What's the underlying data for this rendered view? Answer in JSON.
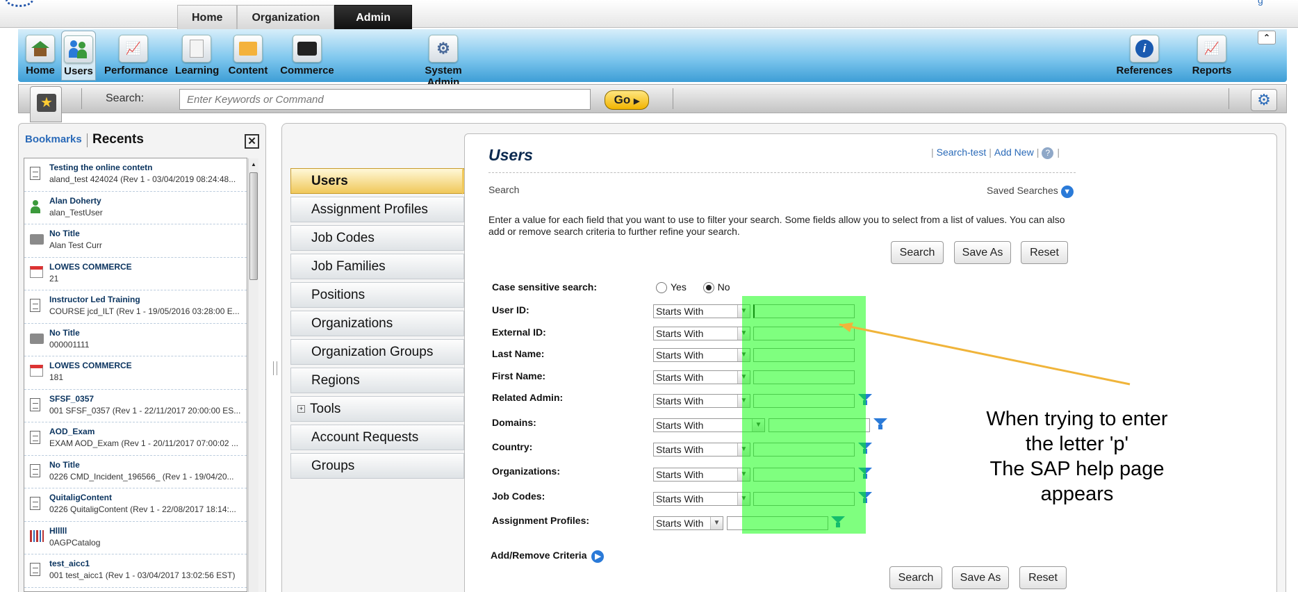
{
  "top_tabs": [
    "Home",
    "Organization",
    "Admin"
  ],
  "nav_items": [
    "Home",
    "Users",
    "Performance",
    "Learning",
    "Content",
    "Commerce",
    "System Admin",
    "References",
    "Reports"
  ],
  "search": {
    "label": "Search:",
    "placeholder": "Enter Keywords or Command",
    "go": "Go"
  },
  "left_panel": {
    "bookmarks_tab": "Bookmarks",
    "recents_tab": "Recents",
    "close": "✕",
    "items": [
      {
        "icon": "document-icon",
        "title": "Testing the online contetn",
        "sub": "aland_test 424024 (Rev 1 - 03/04/2019 08:24:48..."
      },
      {
        "icon": "user-icon",
        "title": "Alan  Doherty",
        "sub": "alan_TestUser"
      },
      {
        "icon": "folder-icon",
        "title": "No Title",
        "sub": "Alan Test Curr"
      },
      {
        "icon": "calendar-icon",
        "title": "LOWES COMMERCE",
        "sub": "21"
      },
      {
        "icon": "document-icon",
        "title": "Instructor Led Training",
        "sub": "COURSE jcd_ILT (Rev 1 - 19/05/2016 03:28:00 E..."
      },
      {
        "icon": "folder-icon",
        "title": "No Title",
        "sub": "000001111"
      },
      {
        "icon": "calendar-icon",
        "title": "LOWES COMMERCE",
        "sub": "181"
      },
      {
        "icon": "document-icon",
        "title": "SFSF_0357",
        "sub": "001 SFSF_0357 (Rev 1 - 22/11/2017 20:00:00 ES..."
      },
      {
        "icon": "document-icon",
        "title": "AOD_Exam",
        "sub": "EXAM AOD_Exam (Rev 1 - 20/11/2017 07:00:02 ..."
      },
      {
        "icon": "document-icon",
        "title": "No Title",
        "sub": "0226 CMD_Incident_196566_ (Rev 1 - 19/04/20..."
      },
      {
        "icon": "document-icon",
        "title": "QuitaligContent",
        "sub": "0226 QuitaligContent (Rev 1 - 22/08/2017 18:14:..."
      },
      {
        "icon": "catalog-icon",
        "title": "Hlllll",
        "sub": "0AGPCatalog"
      },
      {
        "icon": "document-icon",
        "title": "test_aicc1",
        "sub": "001 test_aicc1 (Rev 1 - 03/04/2017 13:02:56 EST)"
      }
    ]
  },
  "sub_nav": [
    "Users",
    "Assignment Profiles",
    "Job Codes",
    "Job Families",
    "Positions",
    "Organizations",
    "Organization Groups",
    "Regions",
    "Tools",
    "Account Requests",
    "Groups"
  ],
  "content": {
    "title": "Users",
    "links": [
      "Search-test",
      "Add New"
    ],
    "help": "?",
    "search_section": "Search",
    "saved_searches": "Saved Searches",
    "instructions": "Enter a value for each field that you want to use to filter your search. Some fields allow you to select from a list of values. You can also add or remove search criteria to further refine your search.",
    "buttons": [
      "Search",
      "Save As",
      "Reset"
    ],
    "case_label": "Case sensitive search:",
    "case_yes": "Yes",
    "case_no": "No",
    "case_selected": "No",
    "fields": [
      {
        "label": "User ID:",
        "op": "Starts With",
        "filter": false
      },
      {
        "label": "External ID:",
        "op": "Starts With",
        "filter": false
      },
      {
        "label": "Last Name:",
        "op": "Starts With",
        "filter": false
      },
      {
        "label": "First Name:",
        "op": "Starts With",
        "filter": false
      },
      {
        "label": "Related Admin:",
        "op": "Starts With",
        "filter": true
      },
      {
        "label": "Domains:",
        "op": "Starts With",
        "filter": true
      },
      {
        "label": "Country:",
        "op": "Starts With",
        "filter": true
      },
      {
        "label": "Organizations:",
        "op": "Starts With",
        "filter": true
      },
      {
        "label": "Job Codes:",
        "op": "Starts With",
        "filter": true
      },
      {
        "label": "Assignment Profiles:",
        "op": "Starts With",
        "filter": true
      }
    ],
    "add_remove": "Add/Remove Criteria"
  },
  "annotation": {
    "lines": [
      "When trying to enter",
      "the letter 'p'",
      "The SAP help page",
      "appears"
    ],
    "highlight_color": "#00ff00",
    "arrow_color": "#f0b43a"
  }
}
